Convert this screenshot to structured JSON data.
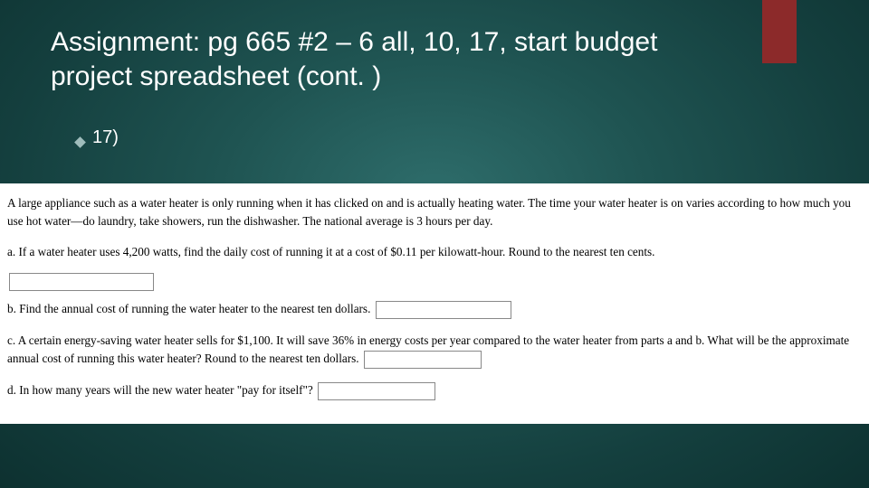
{
  "accent_color": "#8c2a2a",
  "title": "Assignment:  pg 665 #2 – 6 all, 10, 17, start budget project spreadsheet (cont. )",
  "bullet": {
    "label": "17)"
  },
  "problem": {
    "intro": "A large appliance such as a water heater is only running when it has clicked on and is actually heating water. The time your water heater is on varies according to how much you use hot water—do laundry, take showers, run the dishwasher. The national average is 3 hours per day.",
    "parts": {
      "a": "a. If a water heater uses 4,200 watts, find the daily cost of running it at a cost of $0.11 per kilowatt-hour. Round to the nearest ten cents.",
      "b": "b. Find the annual cost of running the water heater to the nearest ten dollars.",
      "c": "c. A certain energy-saving water heater sells for $1,100. It will save 36% in energy costs per year compared to the water heater from parts a and b. What will be the approximate annual cost of running this water heater? Round to the nearest ten dollars.",
      "d": "d. In how many years will the new water heater \"pay for itself\"?"
    },
    "answers": {
      "a": "",
      "b": "",
      "c": "",
      "d": ""
    }
  }
}
